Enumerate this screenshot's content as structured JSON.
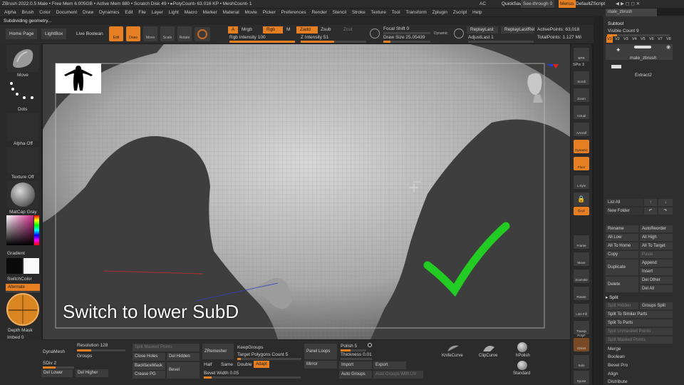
{
  "titlebar": {
    "text": "ZBrush 2022.0.5   Male   • Free Mem 6.005GB • Active Mem 880 • Scratch Disk 49 • ▸PolyCount› 63.016 KP • MeshCount› 1",
    "ac": "AC",
    "quicksave": "QuickSave",
    "seethrough": "See-through   0",
    "menus": "Menus",
    "script": "DefaultZScript"
  },
  "menu_items": [
    "Alpha",
    "Brush",
    "Color",
    "Document",
    "Draw",
    "Dynamics",
    "Edit",
    "File",
    "Layer",
    "Light",
    "Macro",
    "Marker",
    "Material",
    "Movie",
    "Picker",
    "Preferences",
    "Render",
    "Stencil",
    "Stroke",
    "Texture",
    "Tool",
    "Transform",
    "Zplugin",
    "Zscript",
    "Help"
  ],
  "status_text": "Subdividing geometry...",
  "toolbar": {
    "home": "Home Page",
    "lightbox": "LightBox",
    "liveboolean": "Live Boolean",
    "edit": "Edit",
    "draw": "Draw",
    "move": "Move",
    "scale": "Scale",
    "rotate": "Rotate",
    "a": "A",
    "mrgb": "Mrgb",
    "rgb": "Rgb",
    "m": "M",
    "zadd": "Zadd",
    "zsub": "Zsub",
    "zcut": "Zcut",
    "rgb_intensity": "Rgb Intensity 100",
    "z_intensity": "Z Intensity 51",
    "focal_shift": "Focal Shift 0",
    "draw_size": "Draw Size 25.05439",
    "dynamic": "Dynamic",
    "replaylast": "ReplayLast",
    "replaylastrel": "ReplayLastRel",
    "adjustlast": "AdjustLast 1",
    "activepoints": "ActivePoints: 63,018",
    "totalpoints": "TotalPoints: 1.127 Mil"
  },
  "left_panel": {
    "move": "Move",
    "dots": "Dots",
    "alpha_off": "Alpha Off",
    "texture_off": "Texture Off",
    "matcap": "MatCap Gray",
    "gradient": "Gradient",
    "switchcolor": "SwitchColor",
    "alternate": "Alternate",
    "depth_mask": "Depth Mask",
    "imbed": "Imbed 0"
  },
  "caption": "Switch to lower SubD",
  "right_shelf": [
    "BPR",
    "SPix 3",
    "Scroll",
    "Zoom",
    "Actual",
    "AAHalf",
    "Dynamic Persp",
    "Floor",
    "L.Sym",
    "Qxyz",
    "Frame",
    "Move",
    "Zoom3D",
    "Rotate",
    "Line Fill PolyF",
    "Transp",
    "Ghost",
    "Solo",
    "Xpose"
  ],
  "subtool": {
    "header_label": "male_zbrush",
    "title": "Subtool",
    "visible_count": "Visible Count 9",
    "tabs": [
      "V1",
      "V2",
      "V3",
      "V4",
      "V5",
      "V6",
      "V7",
      "V8"
    ],
    "item1": "male_zbrush",
    "item2": "Extract2",
    "list_all": "List All",
    "new_folder": "New Folder",
    "rename": "Rename",
    "autoreorder": "AutoReorder",
    "all_low": "All Low",
    "all_high": "All High",
    "all_to_home": "All To Home",
    "all_to_target": "All To Target",
    "copy": "Copy",
    "paste": "Paste",
    "duplicate": "Duplicate",
    "append": "Append",
    "insert": "Insert",
    "delete": "Delete",
    "del_other": "Del Other",
    "del_all": "Del All",
    "split": "Split",
    "split_hidden": "Split Hidden",
    "groups_split": "Groups Split",
    "split_similar": "Split To Similar Parts",
    "split_parts": "Split To Parts",
    "split_unmasked": "Split Unmasked Points",
    "split_masked": "Split Masked Points",
    "merge": "Merge",
    "boolean": "Boolean",
    "bevel_pro": "Bevel Pro",
    "align": "Align",
    "distribute": "Distribute"
  },
  "bottom": {
    "dynamesh": "DynaMesh",
    "groups": "Groups",
    "resolution": "Resolution 128",
    "sdiv": "SDiv 2",
    "del_lower": "Del Lower",
    "del_higher": "Del Higher",
    "split_masked": "Split Masked Points",
    "close_holes": "Close Holes",
    "del_hidden": "Del Hidden",
    "backface": "BackfaceMask",
    "crease_pg": "Crease PG",
    "bevel": "Bevel",
    "zremesher": "ZRemesher",
    "keepgroups": "KeepGroups",
    "target_poly": "Target Polygons Count 5",
    "half": "Half",
    "same": "Same",
    "double": "Double",
    "adapt": "Adapt",
    "bevel_width": "Bevel Width 0.05",
    "panel_loops": "Panel Loops",
    "mirror": "Mirror",
    "polish": "Polish 5",
    "thickness": "Thickness 0.01",
    "import": "Import",
    "export": "Export",
    "auto_groups": "Auto Groups",
    "auto_groups_uv": "Auto Groups With UV",
    "knifecurve": "KnifeCurve",
    "clipcurve": "ClipCurve",
    "hpolish": "hPolish",
    "standard": "Standard"
  }
}
